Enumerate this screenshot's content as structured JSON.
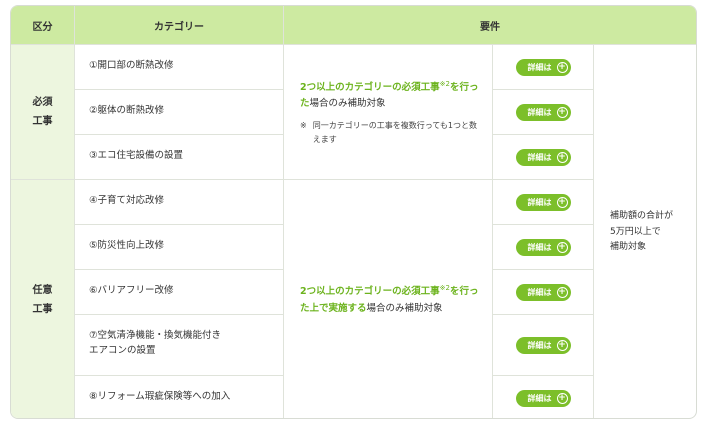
{
  "headers": {
    "division": "区分",
    "category": "カテゴリー",
    "requirement": "要件"
  },
  "groups": [
    {
      "label_line1": "必須",
      "label_line2": "工事"
    },
    {
      "label_line1": "任意",
      "label_line2": "工事"
    }
  ],
  "categories": [
    {
      "line1": "①開口部の断熱改修",
      "line2": ""
    },
    {
      "line1": "②躯体の断熱改修",
      "line2": ""
    },
    {
      "line1": "③エコ住宅設備の設置",
      "line2": ""
    },
    {
      "line1": "④子育て対応改修",
      "line2": ""
    },
    {
      "line1": "⑤防災性向上改修",
      "line2": ""
    },
    {
      "line1": "⑥バリアフリー改修",
      "line2": ""
    },
    {
      "line1": "⑦空気清浄機能・換気機能付き",
      "line2": "エアコンの設置"
    },
    {
      "line1": "⑧リフォーム瑕疵保険等への加入",
      "line2": ""
    }
  ],
  "requirements": {
    "mandatory": {
      "green_text": "2つ以上のカテゴリーの必須工事",
      "sup": "※2",
      "green_text2": "を行った",
      "rest": "場合のみ補助対象",
      "note_mark": "※",
      "note_text": "同一カテゴリーの工事を複数行っても1つと数えます"
    },
    "optional": {
      "green_text": "2つ以上のカテゴリーの必須工事",
      "sup": "※2",
      "green_text2": "を行った上で実施する",
      "rest": "場合のみ補助対象"
    }
  },
  "detail_button_label": "詳細は",
  "total": {
    "line1": "補助額の合計が",
    "line2": "5万円以上で",
    "line3": "補助対象"
  },
  "colors": {
    "header_bg": "#cdeaa1",
    "group_bg": "#edf6df",
    "accent_green": "#7cbf2a"
  }
}
